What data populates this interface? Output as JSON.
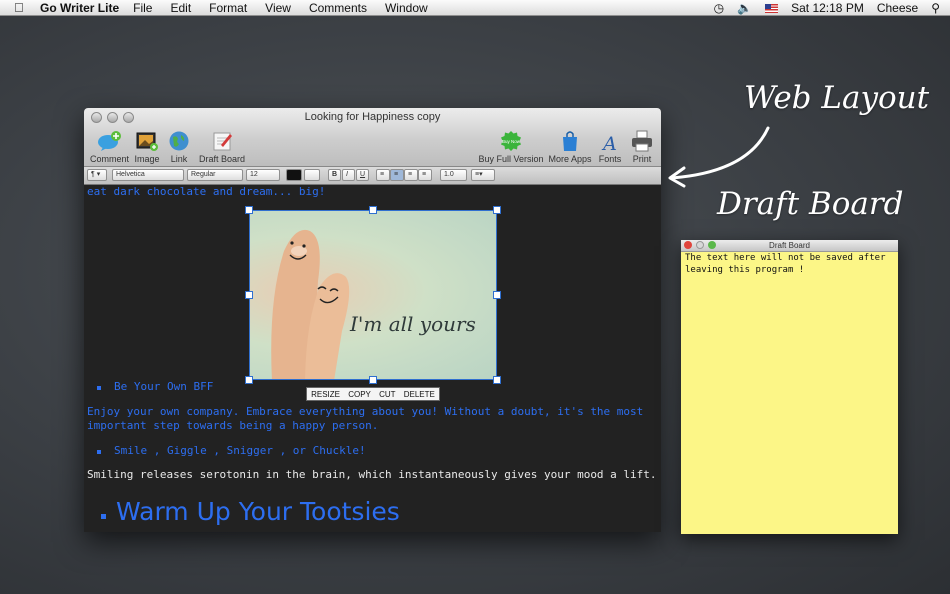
{
  "menubar": {
    "app_name": "Go Writer Lite",
    "items": [
      "File",
      "Edit",
      "Format",
      "View",
      "Comments",
      "Window"
    ],
    "clock": "Sat 12:18 PM",
    "user": "Cheese"
  },
  "window": {
    "title": "Looking for Happiness copy",
    "toolbar": {
      "comment": "Comment",
      "image": "Image",
      "link": "Link",
      "draft_board": "Draft Board",
      "buy_full": "Buy Full Version",
      "more_apps": "More Apps",
      "fonts": "Fonts",
      "print": "Print",
      "buy_badge": "Buy Now"
    },
    "format_bar": {
      "paragraph": "¶",
      "font_family": "Helvetica",
      "font_style": "Regular",
      "font_size": "12",
      "bold": "B",
      "italic": "I",
      "underline": "U",
      "line_spacing": "1.0"
    },
    "content": {
      "line_top": "eat dark chocolate and dream... big!",
      "image_caption": "I'm all yours",
      "image_menu": [
        "RESIZE",
        "COPY",
        "CUT",
        "DELETE"
      ],
      "bullet_1": "Be Your Own BFF",
      "para_1a": "Enjoy your own company. Embrace everything about you! Without a doubt, it's the most",
      "para_1b": "important step towards being a happy person.",
      "bullet_2": "Smile ,  Giggle ,  Snigger , or Chuckle!",
      "para_2": "Smiling releases serotonin in the brain, which instantaneously gives your mood a lift.",
      "heading": "Warm Up Your Tootsies"
    }
  },
  "draft_board": {
    "title": "Draft Board",
    "text": "The text here will not be saved after leaving this program !"
  },
  "annotations": {
    "web_layout": "Web Layout",
    "draft_board": "Draft Board"
  },
  "colors": {
    "text_blue": "#2d6ef0",
    "editor_bg": "#222222",
    "note_yellow": "#fcf687"
  }
}
